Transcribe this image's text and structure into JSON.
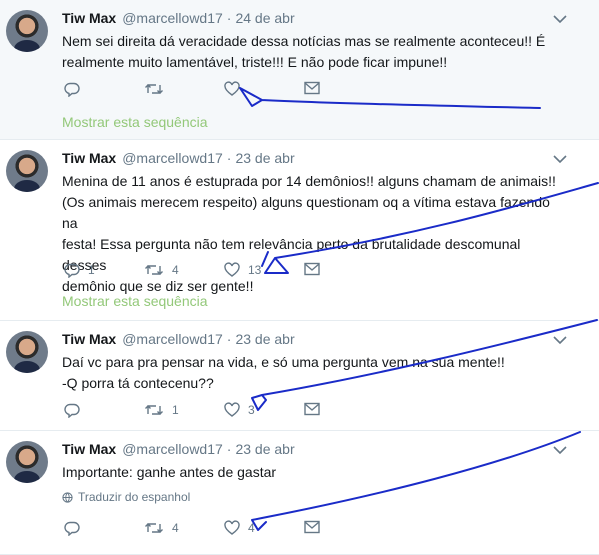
{
  "tweets": [
    {
      "name": "Tiw Max",
      "handle": "@marcellowd17",
      "time": "24 de abr",
      "lines": [
        "Nem sei direita dá veracidade dessa notícias mas se realmente aconteceu!! É",
        "realmente muito lamentável, triste!!! E não pode ficar impune!!"
      ],
      "reply_count": "",
      "retweet_count": "",
      "like_count": "",
      "thread_link": "Mostrar esta sequência"
    },
    {
      "name": "Tiw Max",
      "handle": "@marcellowd17",
      "time": "23 de abr",
      "lines": [
        "Menina de 11 anos é estuprada por 14 demônios!!  alguns chamam de animais!!",
        "(Os animais merecem respeito) alguns questionam oq a vítima estava fazendo na",
        "festa! Essa pergunta não tem relevância perto da brutalidade descomunal desses",
        "demônio que se diz ser gente!!"
      ],
      "reply_count": "1",
      "retweet_count": "4",
      "like_count": "13",
      "thread_link": "Mostrar esta sequência"
    },
    {
      "name": "Tiw Max",
      "handle": "@marcellowd17",
      "time": "23 de abr",
      "lines": [
        "Daí vc para pra pensar na vida, e só uma pergunta vem na sua mente!!",
        "-Q porra tá contecenu??"
      ],
      "reply_count": "",
      "retweet_count": "1",
      "like_count": "3",
      "thread_link": ""
    },
    {
      "name": "Tiw Max",
      "handle": "@marcellowd17",
      "time": "23 de abr",
      "lines": [
        "Importante: ganhe antes de gastar"
      ],
      "translated_note": "Traduzir do espanhol",
      "reply_count": "",
      "retweet_count": "4",
      "like_count": "4",
      "thread_link": ""
    }
  ],
  "icons": {
    "reply": "reply-icon",
    "retweet": "retweet-icon",
    "like": "heart-icon",
    "dm": "envelope-icon",
    "menu": "chevron-down-icon",
    "globe": "globe-icon"
  },
  "colors": {
    "text": "#14171a",
    "muted": "#657786",
    "thread_link": "#93c879",
    "highlight_bg": "#f5f8fa",
    "annotation": "#1a2bc8"
  }
}
